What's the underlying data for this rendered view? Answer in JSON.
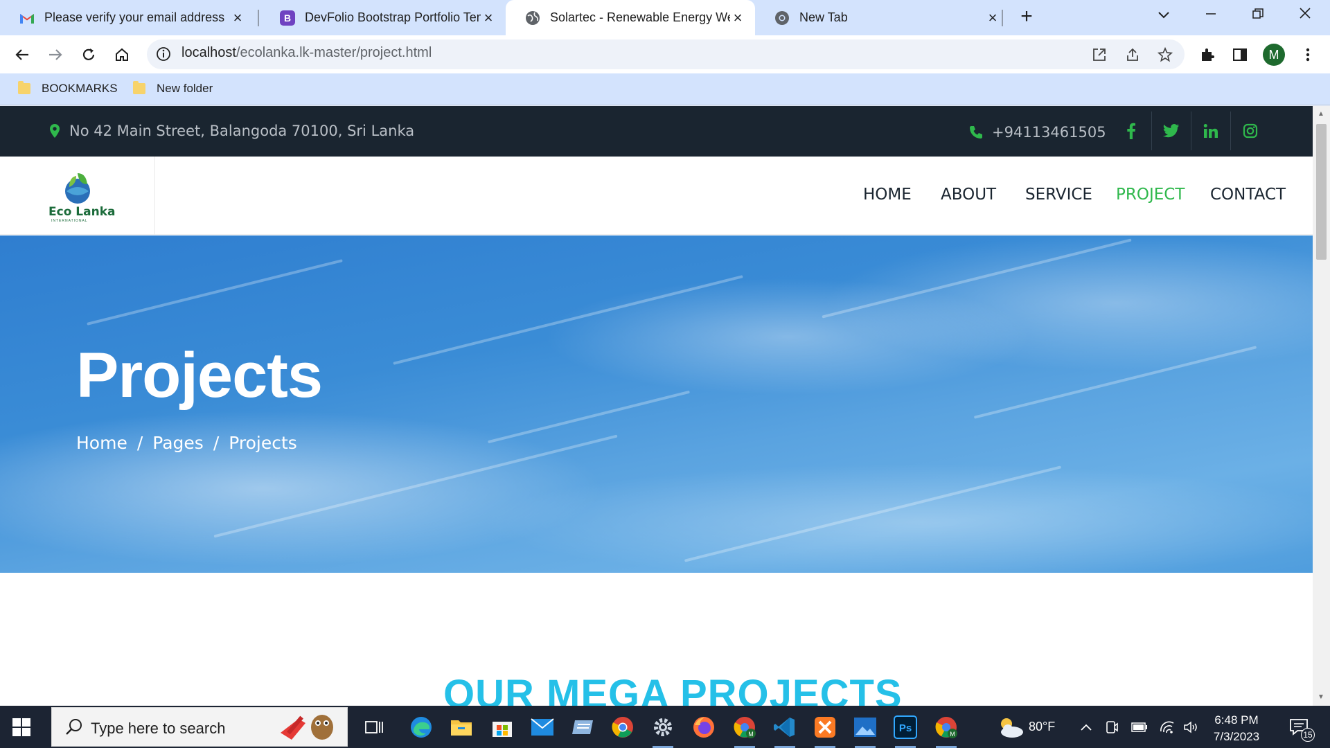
{
  "browser": {
    "tabs": [
      {
        "title": "Please verify your email address",
        "icon": "gmail-icon"
      },
      {
        "title": "DevFolio Bootstrap Portfolio Tem",
        "icon": "bootstrap-icon"
      },
      {
        "title": "Solartec - Renewable Energy Wel",
        "icon": "globe-icon",
        "active": true
      },
      {
        "title": "New Tab",
        "icon": "chrome-icon"
      }
    ],
    "new_tab_label": "+",
    "url_host": "localhost",
    "url_path": "/ecolanka.lk-master/project.html",
    "profile_initial": "M",
    "bookmarks": [
      "BOOKMARKS",
      "New folder"
    ]
  },
  "site": {
    "address": "No 42 Main Street, Balangoda 70100, Sri Lanka",
    "phone": "+94113461505",
    "social": [
      "f",
      "t",
      "in",
      "ig"
    ],
    "logo_text": "Eco Lanka",
    "logo_sub": "INTERNATIONAL",
    "nav": [
      "HOME",
      "ABOUT",
      "SERVICE",
      "PROJECT",
      "CONTACT"
    ],
    "nav_active": "PROJECT",
    "hero_title": "Projects",
    "breadcrumb": [
      "Home",
      "Pages",
      "Projects"
    ],
    "section_title": "OUR MEGA PROJECTS",
    "colors": {
      "accent_green": "#2fb84c",
      "topbar": "#1a2530",
      "section_title": "#25c0e8"
    }
  },
  "taskbar": {
    "search_placeholder": "Type here to search",
    "weather": "80°F",
    "time": "6:48 PM",
    "date": "7/3/2023",
    "notifications": "15"
  }
}
